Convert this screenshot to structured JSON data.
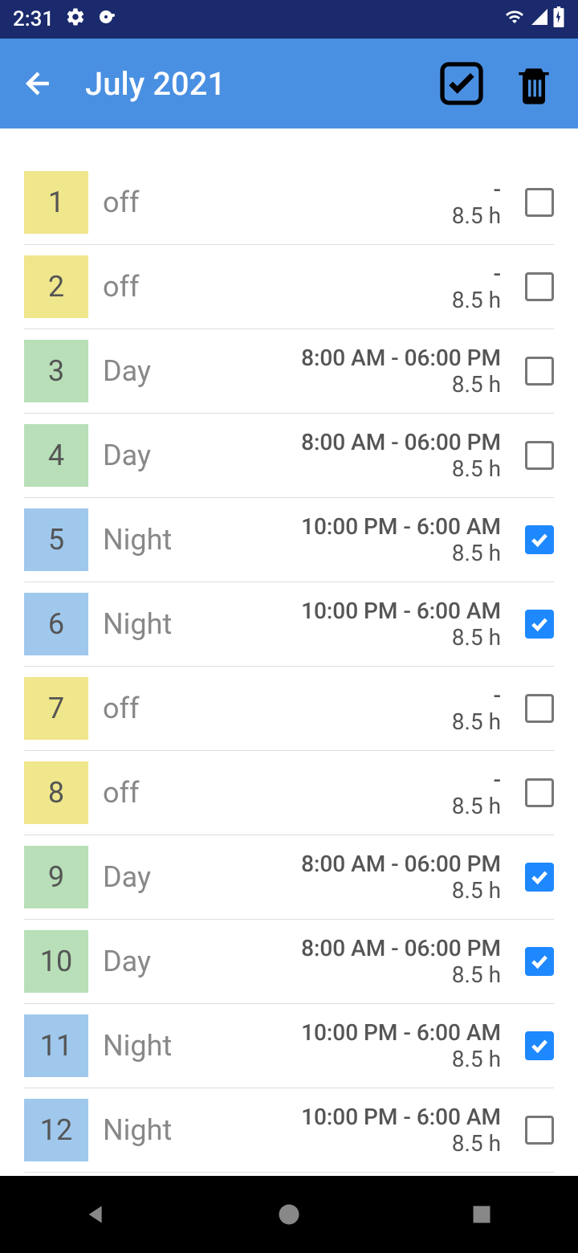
{
  "status": {
    "time": "2:31"
  },
  "header": {
    "title": "July 2021"
  },
  "shifts": [
    {
      "day": "1",
      "label": "off",
      "time": "-",
      "duration": "8.5 h",
      "color": "off",
      "checked": false
    },
    {
      "day": "2",
      "label": "off",
      "time": "-",
      "duration": "8.5 h",
      "color": "off",
      "checked": false
    },
    {
      "day": "3",
      "label": "Day",
      "time": "8:00 AM - 06:00 PM",
      "duration": "8.5 h",
      "color": "day",
      "checked": false
    },
    {
      "day": "4",
      "label": "Day",
      "time": "8:00 AM - 06:00 PM",
      "duration": "8.5 h",
      "color": "day",
      "checked": false
    },
    {
      "day": "5",
      "label": "Night",
      "time": "10:00 PM - 6:00 AM",
      "duration": "8.5 h",
      "color": "night",
      "checked": true
    },
    {
      "day": "6",
      "label": "Night",
      "time": "10:00 PM - 6:00 AM",
      "duration": "8.5 h",
      "color": "night",
      "checked": true
    },
    {
      "day": "7",
      "label": "off",
      "time": "-",
      "duration": "8.5 h",
      "color": "off",
      "checked": false
    },
    {
      "day": "8",
      "label": "off",
      "time": "-",
      "duration": "8.5 h",
      "color": "off",
      "checked": false
    },
    {
      "day": "9",
      "label": "Day",
      "time": "8:00 AM - 06:00 PM",
      "duration": "8.5 h",
      "color": "day",
      "checked": true
    },
    {
      "day": "10",
      "label": "Day",
      "time": "8:00 AM - 06:00 PM",
      "duration": "8.5 h",
      "color": "day",
      "checked": true
    },
    {
      "day": "11",
      "label": "Night",
      "time": "10:00 PM - 6:00 AM",
      "duration": "8.5 h",
      "color": "night",
      "checked": true
    },
    {
      "day": "12",
      "label": "Night",
      "time": "10:00 PM - 6:00 AM",
      "duration": "8.5 h",
      "color": "night",
      "checked": false
    }
  ]
}
